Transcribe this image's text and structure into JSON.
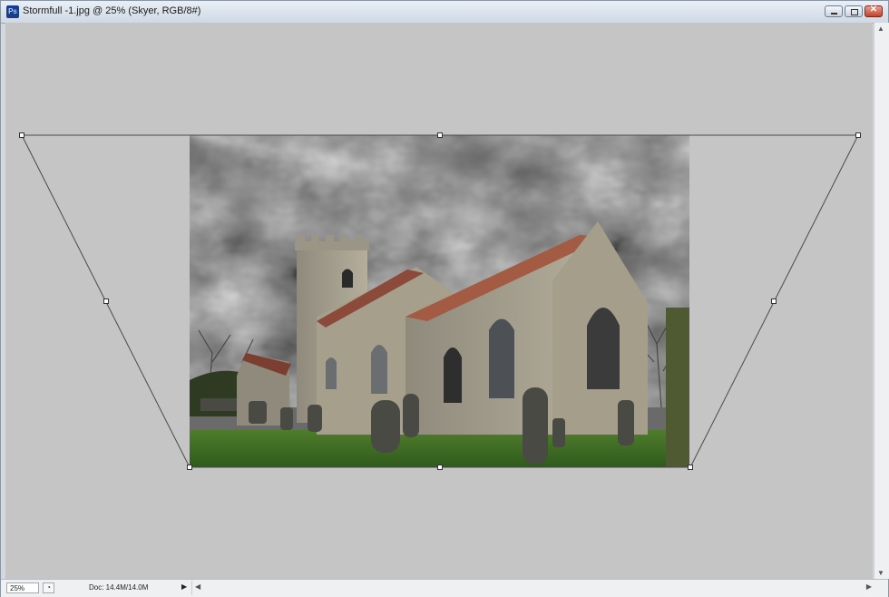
{
  "window": {
    "title": "Stormfull -1.jpg @ 25% (Skyer, RGB/8#)",
    "app_icon_text": "Ps"
  },
  "status": {
    "zoom": "25%",
    "doc_info": "Doc: 14.4M/14.0M"
  },
  "icons": {
    "app": "photoshop-app-icon",
    "minimize": "minimize-icon",
    "maximize": "maximize-icon",
    "close": "close-icon",
    "status_menu": "chevron-right-icon"
  },
  "colors": {
    "canvas_bg": "#c5c5c5",
    "transform_line": "#4a4a4a"
  }
}
